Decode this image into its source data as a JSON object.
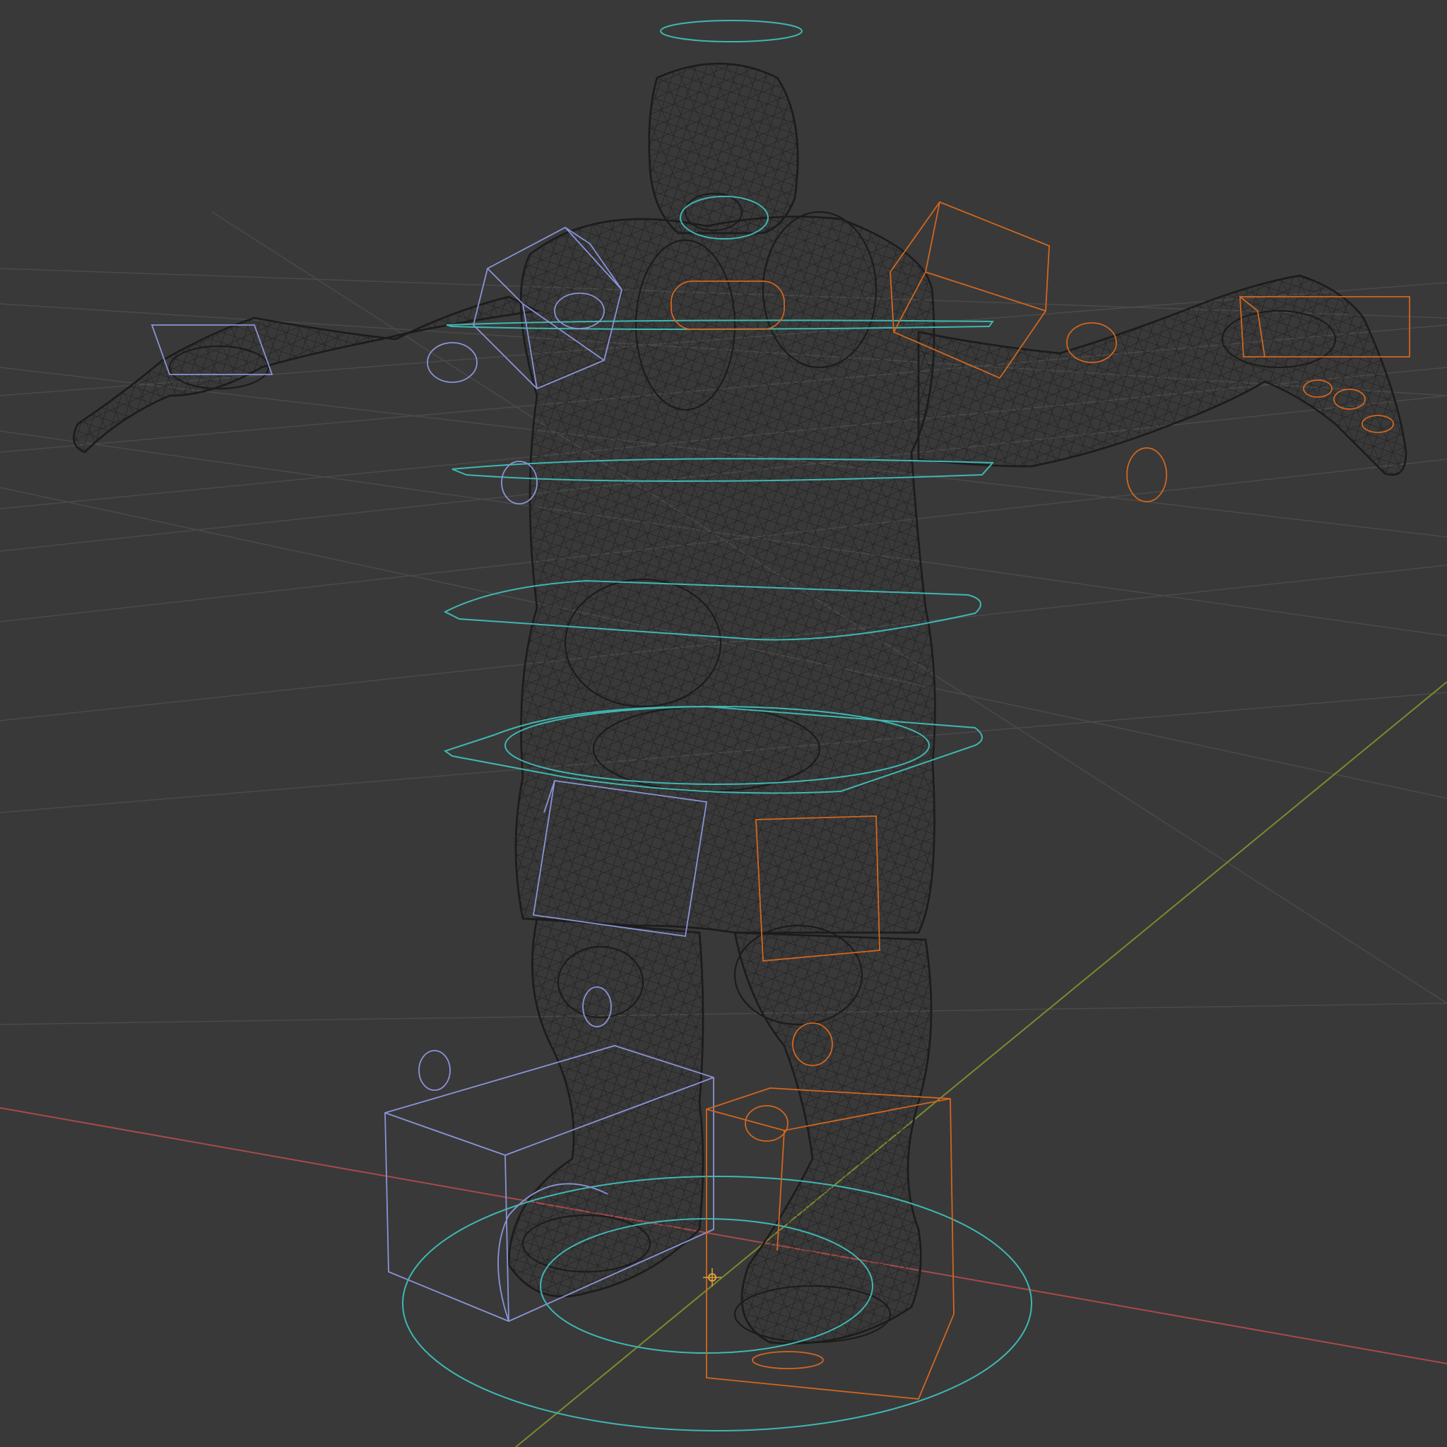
{
  "viewport": {
    "background_color": "#393939",
    "display_mode": "wireframe"
  },
  "colors": {
    "grid_line": "#4a4a4a",
    "x_axis": "#a84a4a",
    "y_axis": "#7e8a2c",
    "mesh_wire": "#1c1c1c",
    "control_cyan": "#3fb7b2",
    "control_left_blue": "#8a93d8",
    "control_right_orange": "#d2661e",
    "origin_marker": "#e6a03c"
  },
  "scene": {
    "object": "character-mesh",
    "armature_controls": [
      "head-ring",
      "neck-ring",
      "shoulder-line",
      "chest-ring",
      "waist-ring",
      "hips-ring",
      "root-ring",
      "left-shoulder-box",
      "right-shoulder-box",
      "left-hand-box",
      "right-hand-box",
      "left-thigh-box",
      "right-thigh-box",
      "left-foot-box",
      "right-foot-box"
    ]
  }
}
